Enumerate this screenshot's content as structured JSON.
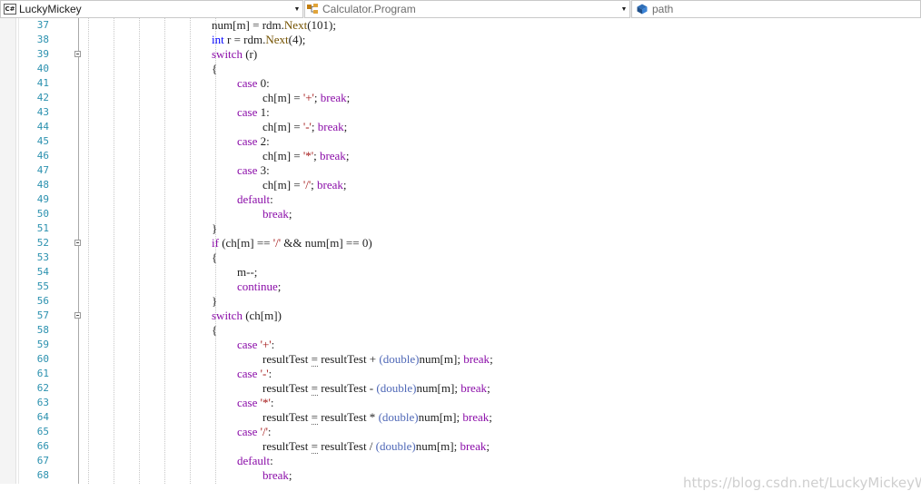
{
  "navbar": {
    "project": "LuckyMickey",
    "project_icon": "C#",
    "type": "Calculator.Program",
    "member": "path"
  },
  "editor": {
    "lines": [
      {
        "n": "37",
        "fold": false
      },
      {
        "n": "38",
        "fold": false
      },
      {
        "n": "39",
        "fold": true
      },
      {
        "n": "40",
        "fold": false
      },
      {
        "n": "41",
        "fold": false
      },
      {
        "n": "42",
        "fold": false
      },
      {
        "n": "43",
        "fold": false
      },
      {
        "n": "44",
        "fold": false
      },
      {
        "n": "45",
        "fold": false
      },
      {
        "n": "46",
        "fold": false
      },
      {
        "n": "47",
        "fold": false
      },
      {
        "n": "48",
        "fold": false
      },
      {
        "n": "49",
        "fold": false
      },
      {
        "n": "50",
        "fold": false
      },
      {
        "n": "51",
        "fold": false
      },
      {
        "n": "52",
        "fold": true
      },
      {
        "n": "53",
        "fold": false
      },
      {
        "n": "54",
        "fold": false
      },
      {
        "n": "55",
        "fold": false
      },
      {
        "n": "56",
        "fold": false
      },
      {
        "n": "57",
        "fold": true
      },
      {
        "n": "58",
        "fold": false
      },
      {
        "n": "59",
        "fold": false
      },
      {
        "n": "60",
        "fold": false
      },
      {
        "n": "61",
        "fold": false
      },
      {
        "n": "62",
        "fold": false
      },
      {
        "n": "63",
        "fold": false
      },
      {
        "n": "64",
        "fold": false
      },
      {
        "n": "65",
        "fold": false
      },
      {
        "n": "66",
        "fold": false
      },
      {
        "n": "67",
        "fold": false
      },
      {
        "n": "68",
        "fold": false
      }
    ],
    "code": [
      {
        "indent": 0,
        "tokens": [
          [
            "num[m] = rdm.",
            ""
          ],
          [
            "Next",
            "mth"
          ],
          [
            "(101);",
            ""
          ]
        ]
      },
      {
        "indent": 0,
        "tokens": [
          [
            "int",
            "blu"
          ],
          [
            " r = rdm.",
            ""
          ],
          [
            "Next",
            "mth"
          ],
          [
            "(4);",
            ""
          ]
        ]
      },
      {
        "indent": 0,
        "tokens": [
          [
            "switch",
            "kw"
          ],
          [
            " (r)",
            ""
          ]
        ]
      },
      {
        "indent": 0,
        "tokens": [
          [
            "{",
            ""
          ]
        ]
      },
      {
        "indent": 1,
        "tokens": [
          [
            "case",
            "kw"
          ],
          [
            " 0:",
            ""
          ]
        ]
      },
      {
        "indent": 2,
        "tokens": [
          [
            "ch[m] = ",
            ""
          ],
          [
            "'+'",
            "str"
          ],
          [
            "; ",
            ""
          ],
          [
            "break",
            "kw"
          ],
          [
            ";",
            ""
          ]
        ]
      },
      {
        "indent": 1,
        "tokens": [
          [
            "case",
            "kw"
          ],
          [
            " 1:",
            ""
          ]
        ]
      },
      {
        "indent": 2,
        "tokens": [
          [
            "ch[m] = ",
            ""
          ],
          [
            "'-'",
            "str"
          ],
          [
            "; ",
            ""
          ],
          [
            "break",
            "kw"
          ],
          [
            ";",
            ""
          ]
        ]
      },
      {
        "indent": 1,
        "tokens": [
          [
            "case",
            "kw"
          ],
          [
            " 2:",
            ""
          ]
        ]
      },
      {
        "indent": 2,
        "tokens": [
          [
            "ch[m] = ",
            ""
          ],
          [
            "'*'",
            "str"
          ],
          [
            "; ",
            ""
          ],
          [
            "break",
            "kw"
          ],
          [
            ";",
            ""
          ]
        ]
      },
      {
        "indent": 1,
        "tokens": [
          [
            "case",
            "kw"
          ],
          [
            " 3:",
            ""
          ]
        ]
      },
      {
        "indent": 2,
        "tokens": [
          [
            "ch[m] = ",
            ""
          ],
          [
            "'/'",
            "str"
          ],
          [
            "; ",
            ""
          ],
          [
            "break",
            "kw"
          ],
          [
            ";",
            ""
          ]
        ]
      },
      {
        "indent": 1,
        "tokens": [
          [
            "default",
            "kw"
          ],
          [
            ":",
            ""
          ]
        ]
      },
      {
        "indent": 2,
        "tokens": [
          [
            "break",
            "kw"
          ],
          [
            ";",
            ""
          ]
        ]
      },
      {
        "indent": 0,
        "tokens": [
          [
            "}",
            ""
          ]
        ]
      },
      {
        "indent": 0,
        "tokens": [
          [
            "if",
            "kw"
          ],
          [
            " (ch[m] == ",
            ""
          ],
          [
            "'/'",
            "str"
          ],
          [
            " && num[m] == 0)",
            ""
          ]
        ]
      },
      {
        "indent": 0,
        "tokens": [
          [
            "{",
            ""
          ]
        ]
      },
      {
        "indent": 1,
        "tokens": [
          [
            "m--;",
            ""
          ]
        ]
      },
      {
        "indent": 1,
        "tokens": [
          [
            "continue",
            "kw"
          ],
          [
            ";",
            ""
          ]
        ]
      },
      {
        "indent": 0,
        "tokens": [
          [
            "}",
            ""
          ]
        ]
      },
      {
        "indent": 0,
        "tokens": [
          [
            "switch",
            "kw"
          ],
          [
            " (ch[m])",
            ""
          ]
        ]
      },
      {
        "indent": 0,
        "tokens": [
          [
            "{",
            ""
          ]
        ]
      },
      {
        "indent": 1,
        "tokens": [
          [
            "case",
            "kw"
          ],
          [
            " ",
            ""
          ],
          [
            "'+'",
            "str"
          ],
          [
            ":",
            ""
          ]
        ]
      },
      {
        "indent": 2,
        "tokens": [
          [
            "resultTest ",
            ""
          ],
          [
            "=",
            "squig"
          ],
          [
            " resultTest + ",
            ""
          ],
          [
            "(double)",
            "cast"
          ],
          [
            "num[m]; ",
            ""
          ],
          [
            "break",
            "kw"
          ],
          [
            ";",
            ""
          ]
        ]
      },
      {
        "indent": 1,
        "tokens": [
          [
            "case",
            "kw"
          ],
          [
            " ",
            ""
          ],
          [
            "'-'",
            "str"
          ],
          [
            ":",
            ""
          ]
        ]
      },
      {
        "indent": 2,
        "tokens": [
          [
            "resultTest ",
            ""
          ],
          [
            "=",
            "squig"
          ],
          [
            " resultTest - ",
            ""
          ],
          [
            "(double)",
            "cast"
          ],
          [
            "num[m]; ",
            ""
          ],
          [
            "break",
            "kw"
          ],
          [
            ";",
            ""
          ]
        ]
      },
      {
        "indent": 1,
        "tokens": [
          [
            "case",
            "kw"
          ],
          [
            " ",
            ""
          ],
          [
            "'*'",
            "str"
          ],
          [
            ":",
            ""
          ]
        ]
      },
      {
        "indent": 2,
        "tokens": [
          [
            "resultTest ",
            ""
          ],
          [
            "=",
            "squig"
          ],
          [
            " resultTest * ",
            ""
          ],
          [
            "(double)",
            "cast"
          ],
          [
            "num[m]; ",
            ""
          ],
          [
            "break",
            "kw"
          ],
          [
            ";",
            ""
          ]
        ]
      },
      {
        "indent": 1,
        "tokens": [
          [
            "case",
            "kw"
          ],
          [
            " ",
            ""
          ],
          [
            "'/'",
            "str"
          ],
          [
            ":",
            ""
          ]
        ]
      },
      {
        "indent": 2,
        "tokens": [
          [
            "resultTest ",
            ""
          ],
          [
            "=",
            "squig"
          ],
          [
            " resultTest / ",
            ""
          ],
          [
            "(double)",
            "cast"
          ],
          [
            "num[m]; ",
            ""
          ],
          [
            "break",
            "kw"
          ],
          [
            ";",
            ""
          ]
        ]
      },
      {
        "indent": 1,
        "tokens": [
          [
            "default",
            "kw"
          ],
          [
            ":",
            ""
          ]
        ]
      },
      {
        "indent": 2,
        "tokens": [
          [
            "break",
            "kw"
          ],
          [
            ";",
            ""
          ]
        ]
      }
    ]
  },
  "watermark": "https://blog.csdn.net/LuckyMickeyW"
}
